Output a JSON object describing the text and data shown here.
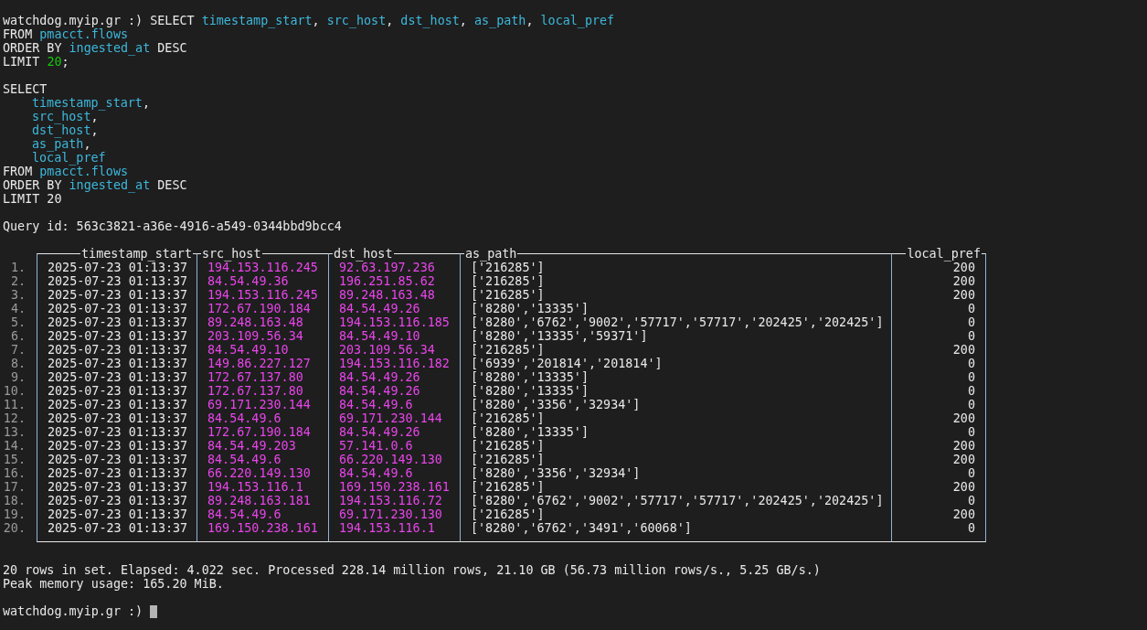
{
  "before": [
    {
      "lines": [
        {
          "segments": [
            {
              "kind": "plain",
              "text": "watchdog.myip.gr :) SELECT "
            },
            {
              "kind": "ident",
              "text": "timestamp_start"
            },
            {
              "kind": "plain",
              "text": ", "
            },
            {
              "kind": "ident",
              "text": "src_host"
            },
            {
              "kind": "plain",
              "text": ", "
            },
            {
              "kind": "ident",
              "text": "dst_host"
            },
            {
              "kind": "plain",
              "text": ", "
            },
            {
              "kind": "ident",
              "text": "as_path"
            },
            {
              "kind": "plain",
              "text": ", "
            },
            {
              "kind": "ident",
              "text": "local_pref"
            }
          ]
        },
        {
          "segments": [
            {
              "kind": "plain",
              "text": "FROM "
            },
            {
              "kind": "ident",
              "text": "pmacct.flows"
            }
          ]
        },
        {
          "segments": [
            {
              "kind": "plain",
              "text": "ORDER BY "
            },
            {
              "kind": "ident",
              "text": "ingested_at"
            },
            {
              "kind": "plain",
              "text": " DESC"
            }
          ]
        },
        {
          "segments": [
            {
              "kind": "plain",
              "text": "LIMIT "
            },
            {
              "kind": "number",
              "text": "20"
            },
            {
              "kind": "plain",
              "text": ";"
            }
          ]
        }
      ]
    },
    {
      "lines": [
        {
          "segments": [
            {
              "kind": "plain",
              "text": "SELECT"
            }
          ]
        },
        {
          "indent": true,
          "segments": [
            {
              "kind": "ident",
              "text": "timestamp_start"
            },
            {
              "kind": "plain",
              "text": ","
            }
          ]
        },
        {
          "indent": true,
          "segments": [
            {
              "kind": "ident",
              "text": "src_host"
            },
            {
              "kind": "plain",
              "text": ","
            }
          ]
        },
        {
          "indent": true,
          "segments": [
            {
              "kind": "ident",
              "text": "dst_host"
            },
            {
              "kind": "plain",
              "text": ","
            }
          ]
        },
        {
          "indent": true,
          "segments": [
            {
              "kind": "ident",
              "text": "as_path"
            },
            {
              "kind": "plain",
              "text": ","
            }
          ]
        },
        {
          "indent": true,
          "segments": [
            {
              "kind": "ident",
              "text": "local_pref"
            }
          ]
        },
        {
          "segments": [
            {
              "kind": "plain",
              "text": "FROM "
            },
            {
              "kind": "ident",
              "text": "pmacct.flows"
            }
          ]
        },
        {
          "segments": [
            {
              "kind": "plain",
              "text": "ORDER BY "
            },
            {
              "kind": "ident",
              "text": "ingested_at"
            },
            {
              "kind": "plain",
              "text": " DESC"
            }
          ]
        },
        {
          "segments": [
            {
              "kind": "plain",
              "text": "LIMIT 20"
            }
          ]
        }
      ]
    },
    {
      "lines": [
        {
          "segments": [
            {
              "kind": "plain",
              "text": "Query id: 563c3821-a36e-4916-a549-0344bbd9bcc4"
            }
          ]
        }
      ]
    }
  ],
  "table": {
    "columns": [
      {
        "name": "timestamp_start",
        "kind": "timestamp"
      },
      {
        "name": "src_host",
        "kind": "ip"
      },
      {
        "name": "dst_host",
        "kind": "ip"
      },
      {
        "name": "as_path",
        "kind": "list"
      },
      {
        "name": "local_pref",
        "kind": "number"
      }
    ],
    "rows": [
      {
        "number": "1.",
        "cells": [
          "2025-07-23 01:13:37",
          "194.153.116.245",
          "92.63.197.236",
          "['216285']",
          "200"
        ]
      },
      {
        "number": "2.",
        "cells": [
          "2025-07-23 01:13:37",
          "84.54.49.36",
          "196.251.85.62",
          "['216285']",
          "200"
        ]
      },
      {
        "number": "3.",
        "cells": [
          "2025-07-23 01:13:37",
          "194.153.116.245",
          "89.248.163.48",
          "['216285']",
          "200"
        ]
      },
      {
        "number": "4.",
        "cells": [
          "2025-07-23 01:13:37",
          "172.67.190.184",
          "84.54.49.26",
          "['8280','13335']",
          "0"
        ]
      },
      {
        "number": "5.",
        "cells": [
          "2025-07-23 01:13:37",
          "89.248.163.48",
          "194.153.116.185",
          "['8280','6762','9002','57717','57717','202425','202425']",
          "0"
        ]
      },
      {
        "number": "6.",
        "cells": [
          "2025-07-23 01:13:37",
          "203.109.56.34",
          "84.54.49.10",
          "['8280','13335','59371']",
          "0"
        ]
      },
      {
        "number": "7.",
        "cells": [
          "2025-07-23 01:13:37",
          "84.54.49.10",
          "203.109.56.34",
          "['216285']",
          "200"
        ]
      },
      {
        "number": "8.",
        "cells": [
          "2025-07-23 01:13:37",
          "149.86.227.127",
          "194.153.116.182",
          "['6939','201814','201814']",
          "0"
        ]
      },
      {
        "number": "9.",
        "cells": [
          "2025-07-23 01:13:37",
          "172.67.137.80",
          "84.54.49.26",
          "['8280','13335']",
          "0"
        ]
      },
      {
        "number": "10.",
        "cells": [
          "2025-07-23 01:13:37",
          "172.67.137.80",
          "84.54.49.26",
          "['8280','13335']",
          "0"
        ]
      },
      {
        "number": "11.",
        "cells": [
          "2025-07-23 01:13:37",
          "69.171.230.144",
          "84.54.49.6",
          "['8280','3356','32934']",
          "0"
        ]
      },
      {
        "number": "12.",
        "cells": [
          "2025-07-23 01:13:37",
          "84.54.49.6",
          "69.171.230.144",
          "['216285']",
          "200"
        ]
      },
      {
        "number": "13.",
        "cells": [
          "2025-07-23 01:13:37",
          "172.67.190.184",
          "84.54.49.26",
          "['8280','13335']",
          "0"
        ]
      },
      {
        "number": "14.",
        "cells": [
          "2025-07-23 01:13:37",
          "84.54.49.203",
          "57.141.0.6",
          "['216285']",
          "200"
        ]
      },
      {
        "number": "15.",
        "cells": [
          "2025-07-23 01:13:37",
          "84.54.49.6",
          "66.220.149.130",
          "['216285']",
          "200"
        ]
      },
      {
        "number": "16.",
        "cells": [
          "2025-07-23 01:13:37",
          "66.220.149.130",
          "84.54.49.6",
          "['8280','3356','32934']",
          "0"
        ]
      },
      {
        "number": "17.",
        "cells": [
          "2025-07-23 01:13:37",
          "194.153.116.1",
          "169.150.238.161",
          "['216285']",
          "200"
        ]
      },
      {
        "number": "18.",
        "cells": [
          "2025-07-23 01:13:37",
          "89.248.163.181",
          "194.153.116.72",
          "['8280','6762','9002','57717','57717','202425','202425']",
          "0"
        ]
      },
      {
        "number": "19.",
        "cells": [
          "2025-07-23 01:13:37",
          "84.54.49.6",
          "69.171.230.130",
          "['216285']",
          "200"
        ]
      },
      {
        "number": "20.",
        "cells": [
          "2025-07-23 01:13:37",
          "169.150.238.161",
          "194.153.116.1",
          "['8280','6762','3491','60068']",
          "0"
        ]
      }
    ]
  },
  "after": [
    {
      "lines": [
        "20 rows in set. Elapsed: 4.022 sec. Processed 228.14 million rows, 21.10 GB (56.73 million rows/s., 5.25 GB/s.)",
        "Peak memory usage: 165.20 MiB."
      ]
    }
  ],
  "prompt": {
    "text": "watchdog.myip.gr :)",
    "cursor": true
  }
}
